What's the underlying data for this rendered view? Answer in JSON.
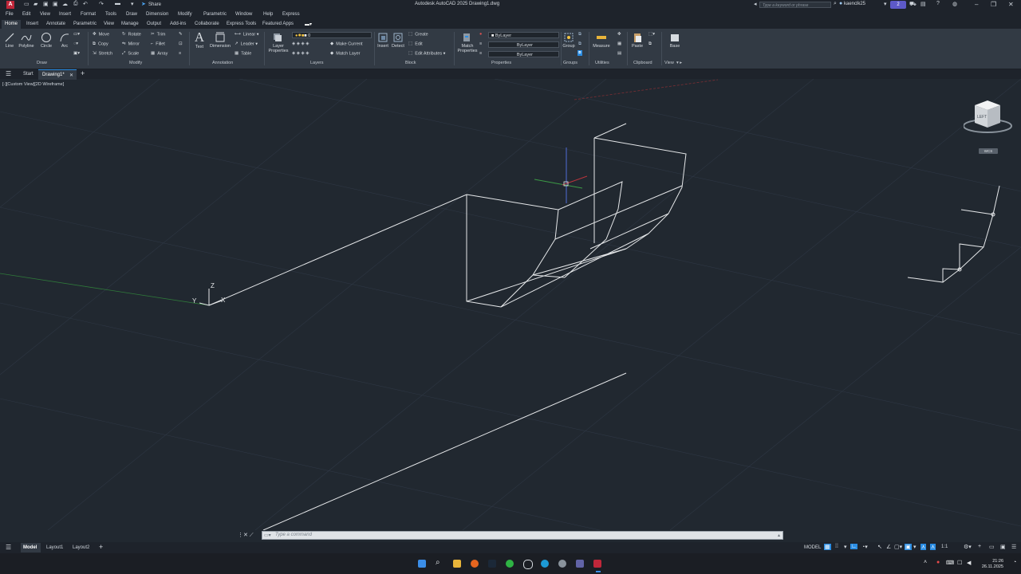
{
  "title_bar": {
    "app_logo": "A",
    "share_label": "Share",
    "window_title": "Autodesk AutoCAD 2025   Drawing1.dwg",
    "search_placeholder": "Type a keyword or phrase",
    "user_name": "kaenclk25",
    "cloud_badge": "2"
  },
  "menu": [
    "File",
    "Edit",
    "View",
    "Insert",
    "Format",
    "Tools",
    "Draw",
    "Dimension",
    "Modify",
    "Parametric",
    "Window",
    "Help",
    "Express"
  ],
  "ribbon_tabs": [
    "Home",
    "Insert",
    "Annotate",
    "Parametric",
    "View",
    "Manage",
    "Output",
    "Add-ins",
    "Collaborate",
    "Express Tools",
    "Featured Apps"
  ],
  "ribbon": {
    "draw": {
      "label": "Draw",
      "tools": [
        "Line",
        "Polyline",
        "Circle",
        "Arc"
      ]
    },
    "modify": {
      "label": "Modify",
      "move": "Move",
      "rotate": "Rotate",
      "trim": "Trim",
      "copy": "Copy",
      "mirror": "Mirror",
      "fillet": "Fillet",
      "stretch": "Stretch",
      "scale": "Scale",
      "array": "Array"
    },
    "annotation": {
      "label": "Annotation",
      "text": "Text",
      "dimension": "Dimension",
      "linear": "Linear",
      "leader": "Leader",
      "table": "Table"
    },
    "layers": {
      "label": "Layers",
      "layer_properties": "Layer Properties",
      "current_layer": "0",
      "make_current": "Make Current",
      "match_layer": "Match Layer"
    },
    "block": {
      "label": "Block",
      "insert": "Insert",
      "detect": "Detect",
      "create": "Create",
      "edit": "Edit",
      "edit_attributes": "Edit Attributes"
    },
    "properties": {
      "label": "Properties",
      "match_properties": "Match Properties",
      "color": "ByLayer",
      "linetype": "ByLayer",
      "lineweight": "ByLayer"
    },
    "groups": {
      "label": "Groups",
      "group": "Group"
    },
    "utilities": {
      "label": "Utilities",
      "measure": "Measure"
    },
    "clipboard": {
      "label": "Clipboard",
      "paste": "Paste"
    },
    "view": {
      "label": "View",
      "base": "Base"
    }
  },
  "file_tabs": {
    "start": "Start",
    "drawing": "Drawing1*"
  },
  "viewport_label": "[-][Custom View][2D Wireframe]",
  "viewcube": {
    "face": "LEFT",
    "wcs": "WCS"
  },
  "ucs_axes": {
    "x": "X",
    "y": "Y",
    "z": "Z"
  },
  "command_line": {
    "placeholder": "Type a command"
  },
  "layout_tabs": [
    "Model",
    "Layout1",
    "Layout2"
  ],
  "status": {
    "model": "MODEL",
    "scale": "1:1"
  },
  "clock": {
    "time": "21:26",
    "date": "26.11.2025"
  },
  "colors": {
    "background": "#212830",
    "ribbon": "#323a44",
    "accent": "#2b8de3",
    "geometry": "#e6e8ea"
  }
}
